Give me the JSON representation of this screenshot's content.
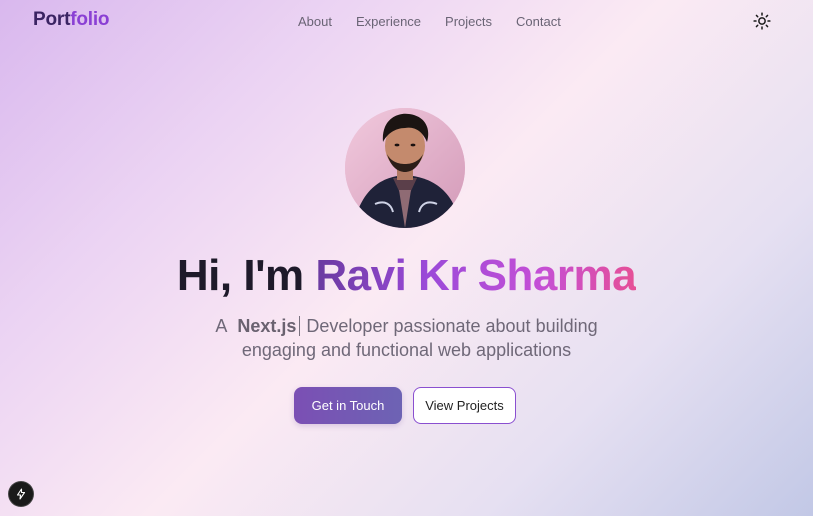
{
  "header": {
    "brand_part1": "Port",
    "brand_part2": "folio",
    "nav": [
      "About",
      "Experience",
      "Projects",
      "Contact"
    ],
    "theme_icon": "sun-icon"
  },
  "hero": {
    "avatar_alt": "profile-photo",
    "greeting": "Hi, I'm ",
    "name": "Ravi Kr Sharma",
    "tagline_prefix": "A",
    "tagline_tech": "Next.js",
    "tagline_rest": "Developer passionate about building engaging and functional web applications",
    "primary_button": "Get in Touch",
    "secondary_button": "View Projects"
  },
  "dev_badge": {
    "icon": "lightning-icon"
  },
  "colors": {
    "brand_dark": "#3b2463",
    "brand_accent": "#8a3fd4",
    "name_gradient_start": "#6a3aa0",
    "name_gradient_end": "#e64f96",
    "primary_button": "#7b4fb4",
    "secondary_border": "#8a4fd0"
  }
}
